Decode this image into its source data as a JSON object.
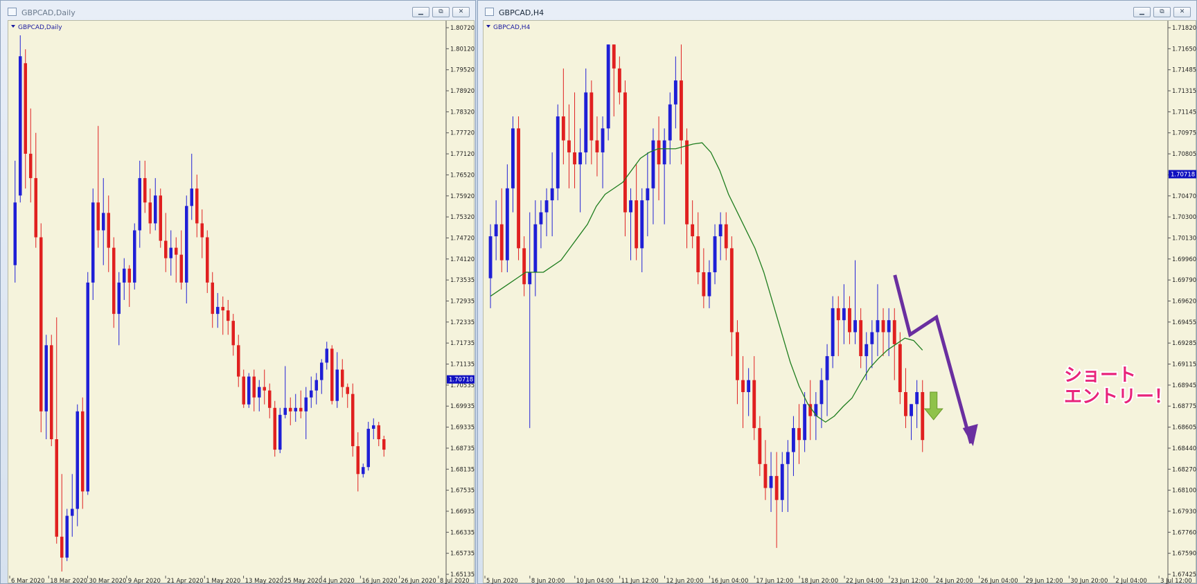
{
  "windows": [
    {
      "title": "GBPCAD,Daily",
      "buttons": {
        "minimize": "▁",
        "restore": "⧉",
        "close": "✕"
      },
      "active": false
    },
    {
      "title": "GBPCAD,H4",
      "buttons": {
        "minimize": "▁",
        "restore": "⧉",
        "close": "✕"
      },
      "active": true
    }
  ],
  "annotation": {
    "line1": "ショート",
    "line2": "エントリー！",
    "color": "#e8237a",
    "arrow_color": "#6a2fa0",
    "green_arrow_color": "#8fc24a"
  },
  "colors": {
    "bull": "#1f1fd6",
    "bear": "#e02020",
    "ma": "#1e7d1e",
    "background": "#f5f3dc",
    "price_tag": "#1010c0"
  },
  "chart_data": [
    {
      "type": "candlestick",
      "symbol_label": "GBPCAD,Daily",
      "ylim": [
        1.6512,
        1.8082
      ],
      "y_ticks": [
        "1.80720",
        "1.80120",
        "1.79520",
        "1.78920",
        "1.78320",
        "1.77720",
        "1.77120",
        "1.76520",
        "1.75920",
        "1.75320",
        "1.74720",
        "1.74120",
        "1.73535",
        "1.72935",
        "1.72335",
        "1.71735",
        "1.71135",
        "1.70535",
        "1.69935",
        "1.69335",
        "1.68735",
        "1.68135",
        "1.67535",
        "1.66935",
        "1.66335",
        "1.65735",
        "1.65135"
      ],
      "x_ticks": [
        "6 Mar 2020",
        "18 Mar 2020",
        "30 Mar 2020",
        "9 Apr 2020",
        "21 Apr 2020",
        "1 May 2020",
        "13 May 2020",
        "25 May 2020",
        "4 Jun 2020",
        "16 Jun 2020",
        "26 Jun 2020",
        "8 Jul 2020"
      ],
      "last_price": "1.70718",
      "candles": [
        [
          1.74,
          1.77,
          1.735,
          1.758
        ],
        [
          1.76,
          1.806,
          1.758,
          1.8
        ],
        [
          1.798,
          1.802,
          1.762,
          1.772
        ],
        [
          1.772,
          1.785,
          1.758,
          1.765
        ],
        [
          1.765,
          1.778,
          1.745,
          1.748
        ],
        [
          1.748,
          1.752,
          1.692,
          1.698
        ],
        [
          1.698,
          1.72,
          1.69,
          1.717
        ],
        [
          1.717,
          1.72,
          1.688,
          1.69
        ],
        [
          1.69,
          1.725,
          1.66,
          1.662
        ],
        [
          1.662,
          1.68,
          1.652,
          1.656
        ],
        [
          1.656,
          1.67,
          1.655,
          1.668
        ],
        [
          1.668,
          1.68,
          1.662,
          1.67
        ],
        [
          1.67,
          1.7,
          1.665,
          1.698
        ],
        [
          1.698,
          1.702,
          1.67,
          1.675
        ],
        [
          1.675,
          1.738,
          1.674,
          1.735
        ],
        [
          1.735,
          1.762,
          1.73,
          1.758
        ],
        [
          1.758,
          1.78,
          1.745,
          1.75
        ],
        [
          1.75,
          1.765,
          1.74,
          1.755
        ],
        [
          1.755,
          1.76,
          1.738,
          1.745
        ],
        [
          1.745,
          1.748,
          1.722,
          1.726
        ],
        [
          1.726,
          1.738,
          1.717,
          1.735
        ],
        [
          1.735,
          1.742,
          1.73,
          1.739
        ],
        [
          1.739,
          1.74,
          1.728,
          1.735
        ],
        [
          1.735,
          1.752,
          1.733,
          1.75
        ],
        [
          1.75,
          1.77,
          1.745,
          1.765
        ],
        [
          1.765,
          1.77,
          1.755,
          1.758
        ],
        [
          1.758,
          1.762,
          1.749,
          1.752
        ],
        [
          1.752,
          1.765,
          1.75,
          1.76
        ],
        [
          1.76,
          1.762,
          1.745,
          1.747
        ],
        [
          1.747,
          1.755,
          1.738,
          1.742
        ],
        [
          1.742,
          1.75,
          1.737,
          1.745
        ],
        [
          1.745,
          1.748,
          1.735,
          1.743
        ],
        [
          1.743,
          1.75,
          1.733,
          1.735
        ],
        [
          1.735,
          1.76,
          1.729,
          1.757
        ],
        [
          1.757,
          1.772,
          1.753,
          1.762
        ],
        [
          1.762,
          1.766,
          1.748,
          1.752
        ],
        [
          1.752,
          1.756,
          1.742,
          1.748
        ],
        [
          1.748,
          1.75,
          1.732,
          1.735
        ],
        [
          1.735,
          1.738,
          1.722,
          1.726
        ],
        [
          1.726,
          1.732,
          1.722,
          1.728
        ],
        [
          1.728,
          1.731,
          1.72,
          1.727
        ],
        [
          1.727,
          1.73,
          1.72,
          1.724
        ],
        [
          1.724,
          1.726,
          1.714,
          1.717
        ],
        [
          1.717,
          1.72,
          1.705,
          1.708
        ],
        [
          1.708,
          1.71,
          1.699,
          1.7
        ],
        [
          1.7,
          1.709,
          1.699,
          1.708
        ],
        [
          1.708,
          1.71,
          1.698,
          1.702
        ],
        [
          1.702,
          1.707,
          1.698,
          1.705
        ],
        [
          1.705,
          1.71,
          1.7,
          1.704
        ],
        [
          1.704,
          1.706,
          1.696,
          1.699
        ],
        [
          1.699,
          1.701,
          1.685,
          1.687
        ],
        [
          1.687,
          1.699,
          1.686,
          1.697
        ],
        [
          1.697,
          1.711,
          1.696,
          1.699
        ],
        [
          1.699,
          1.702,
          1.694,
          1.698
        ],
        [
          1.698,
          1.703,
          1.695,
          1.699
        ],
        [
          1.699,
          1.704,
          1.696,
          1.698
        ],
        [
          1.698,
          1.705,
          1.69,
          1.702
        ],
        [
          1.702,
          1.708,
          1.699,
          1.704
        ],
        [
          1.704,
          1.709,
          1.7,
          1.707
        ],
        [
          1.707,
          1.713,
          1.703,
          1.712
        ],
        [
          1.712,
          1.718,
          1.71,
          1.716
        ],
        [
          1.716,
          1.717,
          1.7,
          1.701
        ],
        [
          1.701,
          1.715,
          1.699,
          1.71
        ],
        [
          1.71,
          1.713,
          1.702,
          1.705
        ],
        [
          1.705,
          1.706,
          1.699,
          1.703
        ],
        [
          1.703,
          1.706,
          1.685,
          1.688
        ],
        [
          1.688,
          1.692,
          1.675,
          1.68
        ],
        [
          1.68,
          1.683,
          1.679,
          1.682
        ],
        [
          1.682,
          1.695,
          1.681,
          1.693
        ],
        [
          1.693,
          1.696,
          1.69,
          1.694
        ],
        [
          1.694,
          1.695,
          1.688,
          1.69
        ],
        [
          1.69,
          1.691,
          1.685,
          1.687
        ]
      ]
    },
    {
      "type": "candlestick",
      "symbol_label": "GBPCAD,H4",
      "ylim": [
        1.6738,
        1.7194
      ],
      "y_ticks": [
        "1.71820",
        "1.71650",
        "1.71485",
        "1.71315",
        "1.71145",
        "1.70975",
        "1.70805",
        "1.70635",
        "1.70470",
        "1.70300",
        "1.70130",
        "1.69960",
        "1.69790",
        "1.69620",
        "1.69455",
        "1.69285",
        "1.69115",
        "1.68945",
        "1.68775",
        "1.68605",
        "1.68440",
        "1.68270",
        "1.68100",
        "1.67930",
        "1.67760",
        "1.67590",
        "1.67425"
      ],
      "x_ticks": [
        "5 Jun 2020",
        "8 Jun 20:00",
        "10 Jun 04:00",
        "11 Jun 12:00",
        "12 Jun 20:00",
        "16 Jun 04:00",
        "17 Jun 12:00",
        "18 Jun 20:00",
        "22 Jun 04:00",
        "23 Jun 12:00",
        "24 Jun 20:00",
        "26 Jun 04:00",
        "29 Jun 12:00",
        "30 Jun 20:00",
        "2 Jul 04:00",
        "3 Jul 12:00"
      ],
      "last_price": "1.70718",
      "ma_label": "",
      "candles": [
        [
          1.6985,
          1.703,
          1.696,
          1.702
        ],
        [
          1.702,
          1.705,
          1.7,
          1.703
        ],
        [
          1.703,
          1.706,
          1.699,
          1.7
        ],
        [
          1.7,
          1.708,
          1.699,
          1.706
        ],
        [
          1.706,
          1.712,
          1.704,
          1.711
        ],
        [
          1.711,
          1.712,
          1.7,
          1.701
        ],
        [
          1.701,
          1.702,
          1.697,
          1.698
        ],
        [
          1.698,
          1.704,
          1.686,
          1.699
        ],
        [
          1.699,
          1.705,
          1.697,
          1.703
        ],
        [
          1.703,
          1.705,
          1.701,
          1.704
        ],
        [
          1.704,
          1.706,
          1.702,
          1.705
        ],
        [
          1.705,
          1.709,
          1.702,
          1.706
        ],
        [
          1.706,
          1.713,
          1.705,
          1.712
        ],
        [
          1.712,
          1.716,
          1.708,
          1.71
        ],
        [
          1.71,
          1.713,
          1.706,
          1.709
        ],
        [
          1.709,
          1.714,
          1.706,
          1.708
        ],
        [
          1.708,
          1.711,
          1.704,
          1.709
        ],
        [
          1.709,
          1.716,
          1.708,
          1.714
        ],
        [
          1.714,
          1.715,
          1.708,
          1.71
        ],
        [
          1.71,
          1.712,
          1.707,
          1.709
        ],
        [
          1.709,
          1.712,
          1.706,
          1.711
        ],
        [
          1.711,
          1.718,
          1.71,
          1.718
        ],
        [
          1.718,
          1.718,
          1.712,
          1.716
        ],
        [
          1.716,
          1.717,
          1.713,
          1.714
        ],
        [
          1.714,
          1.715,
          1.702,
          1.704
        ],
        [
          1.704,
          1.706,
          1.7,
          1.705
        ],
        [
          1.705,
          1.708,
          1.7,
          1.701
        ],
        [
          1.701,
          1.706,
          1.699,
          1.705
        ],
        [
          1.705,
          1.709,
          1.702,
          1.706
        ],
        [
          1.706,
          1.711,
          1.703,
          1.71
        ],
        [
          1.71,
          1.712,
          1.705,
          1.708
        ],
        [
          1.708,
          1.711,
          1.703,
          1.71
        ],
        [
          1.71,
          1.714,
          1.708,
          1.713
        ],
        [
          1.713,
          1.717,
          1.711,
          1.715
        ],
        [
          1.715,
          1.718,
          1.708,
          1.71
        ],
        [
          1.71,
          1.711,
          1.701,
          1.703
        ],
        [
          1.703,
          1.705,
          1.701,
          1.702
        ],
        [
          1.702,
          1.704,
          1.698,
          1.699
        ],
        [
          1.699,
          1.701,
          1.696,
          1.697
        ],
        [
          1.697,
          1.7,
          1.696,
          1.699
        ],
        [
          1.699,
          1.703,
          1.698,
          1.702
        ],
        [
          1.702,
          1.704,
          1.7,
          1.703
        ],
        [
          1.703,
          1.704,
          1.7,
          1.701
        ],
        [
          1.701,
          1.702,
          1.692,
          1.694
        ],
        [
          1.694,
          1.695,
          1.688,
          1.69
        ],
        [
          1.69,
          1.692,
          1.686,
          1.689
        ],
        [
          1.689,
          1.691,
          1.687,
          1.69
        ],
        [
          1.69,
          1.692,
          1.685,
          1.686
        ],
        [
          1.686,
          1.687,
          1.682,
          1.683
        ],
        [
          1.683,
          1.685,
          1.68,
          1.681
        ],
        [
          1.681,
          1.684,
          1.679,
          1.682
        ],
        [
          1.682,
          1.684,
          1.676,
          1.68
        ],
        [
          1.68,
          1.684,
          1.679,
          1.683
        ],
        [
          1.683,
          1.685,
          1.679,
          1.684
        ],
        [
          1.684,
          1.687,
          1.682,
          1.686
        ],
        [
          1.686,
          1.688,
          1.683,
          1.685
        ],
        [
          1.685,
          1.689,
          1.684,
          1.688
        ],
        [
          1.688,
          1.69,
          1.685,
          1.687
        ],
        [
          1.687,
          1.689,
          1.685,
          1.688
        ],
        [
          1.688,
          1.691,
          1.686,
          1.69
        ],
        [
          1.69,
          1.693,
          1.687,
          1.692
        ],
        [
          1.692,
          1.697,
          1.691,
          1.696
        ],
        [
          1.696,
          1.697,
          1.692,
          1.695
        ],
        [
          1.695,
          1.698,
          1.693,
          1.696
        ],
        [
          1.696,
          1.697,
          1.693,
          1.694
        ],
        [
          1.694,
          1.7,
          1.693,
          1.695
        ],
        [
          1.695,
          1.696,
          1.691,
          1.692
        ],
        [
          1.692,
          1.694,
          1.69,
          1.693
        ],
        [
          1.693,
          1.695,
          1.691,
          1.694
        ],
        [
          1.694,
          1.698,
          1.692,
          1.695
        ],
        [
          1.695,
          1.696,
          1.692,
          1.694
        ],
        [
          1.694,
          1.696,
          1.692,
          1.695
        ],
        [
          1.695,
          1.696,
          1.69,
          1.693
        ],
        [
          1.693,
          1.694,
          1.688,
          1.689
        ],
        [
          1.689,
          1.691,
          1.686,
          1.687
        ],
        [
          1.687,
          1.688,
          1.685,
          1.688
        ],
        [
          1.688,
          1.69,
          1.686,
          1.689
        ],
        [
          1.689,
          1.69,
          1.684,
          1.685
        ]
      ],
      "ma": [
        1.697,
        1.6975,
        1.698,
        1.6985,
        1.699,
        1.699,
        1.699,
        1.6995,
        1.7,
        1.701,
        1.702,
        1.703,
        1.7045,
        1.7055,
        1.706,
        1.7065,
        1.7075,
        1.7085,
        1.709,
        1.7093,
        1.7093,
        1.7093,
        1.7095,
        1.7097,
        1.7098,
        1.709,
        1.7075,
        1.7055,
        1.704,
        1.7025,
        1.701,
        1.699,
        1.6965,
        1.694,
        1.6915,
        1.6895,
        1.688,
        1.687,
        1.6865,
        1.687,
        1.6878,
        1.6885,
        1.6898,
        1.691,
        1.6918,
        1.6925,
        1.693,
        1.6935,
        1.6933,
        1.6925
      ]
    }
  ]
}
